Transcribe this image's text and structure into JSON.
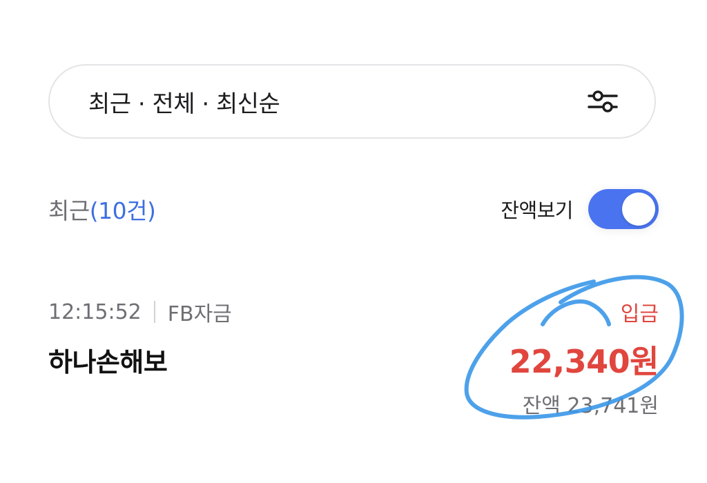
{
  "filter": {
    "label": "최근 · 전체 · 최신순",
    "icon": "sliders-icon"
  },
  "summary": {
    "title": "최근",
    "count": "(10건)",
    "balance_label": "잔액보기",
    "balance_toggle_on": true
  },
  "transaction": {
    "time": "12:15:52",
    "category": "FB자금",
    "name": "하나손해보",
    "type": "입금",
    "amount": "22,340원",
    "balance": "잔액 23,741원"
  },
  "colors": {
    "accent_blue": "#4a74ef",
    "count_blue": "#3d6fe0",
    "deposit_red": "#e0463e",
    "annotation_blue": "#3a97e8"
  }
}
